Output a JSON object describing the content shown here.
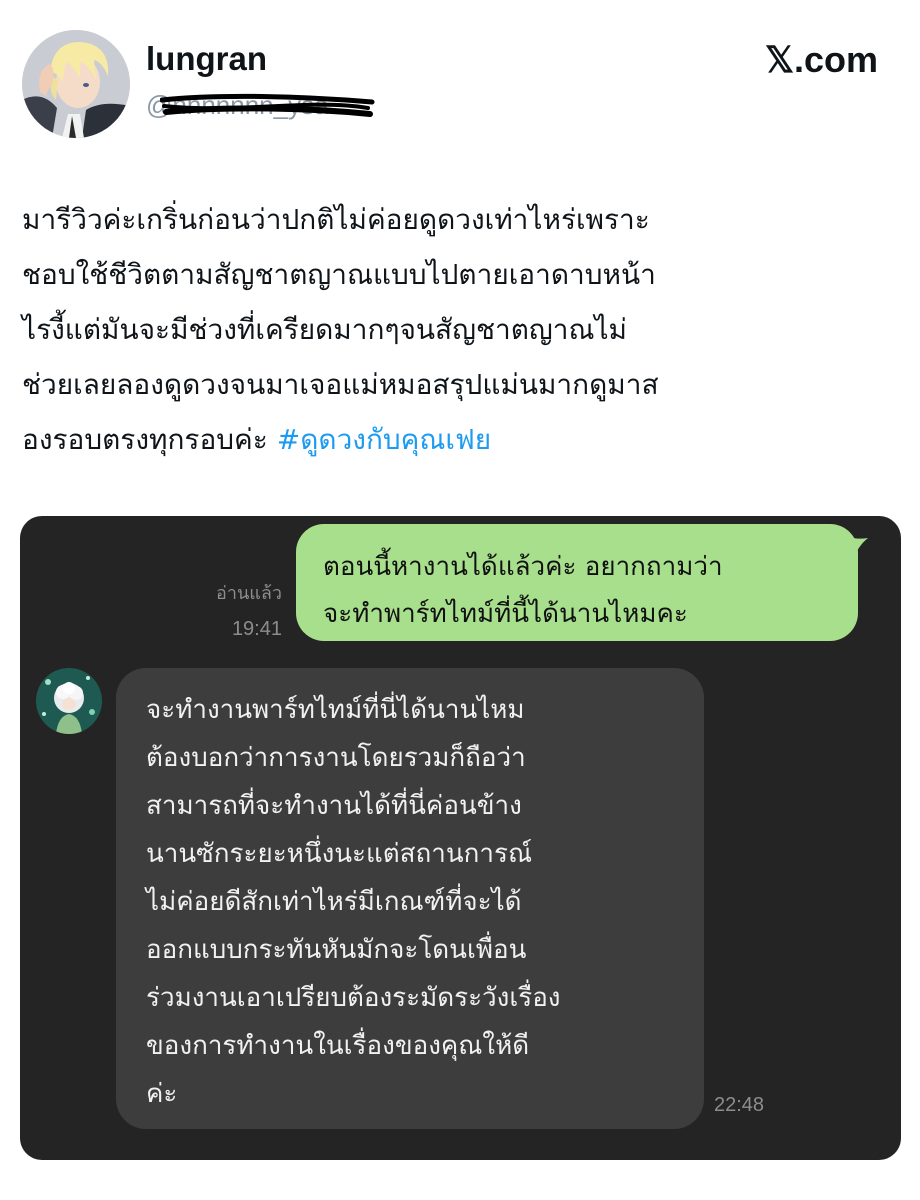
{
  "author": {
    "display_name": "lungran",
    "handle": "@nnnnnnn_ysa"
  },
  "brand": {
    "site_logo": "𝕏.com"
  },
  "tweet": {
    "lines": [
      "มารีวิวค่ะเกริ่นก่อนว่าปกติไม่ค่อยดูดวงเท่าไหร่เพราะ",
      "ชอบใช้ชีวิตตามสัญชาตญาณแบบไปตายเอาดาบหน้า",
      "ไรงี้แต่มันจะมีช่วงที่เครียดมากๆจนสัญชาตญาณไม่",
      "ช่วยเลยลองดูดวงจนมาเจอแม่หมอสรุปแม่นมากดูมาส"
    ],
    "last_line_text": "องรอบตรงทุกรอบค่ะ ",
    "hashtag": "#ดูดวงกับคุณเฟย"
  },
  "chat": {
    "outgoing": {
      "lines": [
        "ตอนนี้หางานได้แล้วค่ะ อยากถามว่า",
        "จะทำพาร์ทไทม์ที่นี้ได้นานไหมคะ"
      ],
      "read_status": "อ่านแล้ว",
      "time": "19:41"
    },
    "incoming": {
      "lines": [
        "จะทำงานพาร์ทไทม์ที่นี่ได้นานไหม",
        "ต้องบอกว่าการงานโดยรวมก็ถือว่า",
        "สามารถที่จะทำงานได้ที่นี่ค่อนข้าง",
        "นานซักระยะหนึ่งนะแต่สถานการณ์",
        "ไม่ค่อยดีสักเท่าไหร่มีเกณฑ์ที่จะได้",
        "ออกแบบกระทันหันมักจะโดนเพื่อน",
        "ร่วมงานเอาเปรียบต้องระมัดระวังเรื่อง",
        "ของการทำงานในเรื่องของคุณให้ดี",
        "ค่ะ"
      ],
      "time": "22:48"
    }
  },
  "icons": {
    "profile_avatar": "anime-avatar-icon",
    "contact_avatar": "contact-avatar-icon"
  },
  "colors": {
    "text": "#0f1419",
    "handle": "#8b98a5",
    "hashtag": "#1d9bf0",
    "media_background": "#242424",
    "outgoing_bubble": "#a8df8c",
    "incoming_bubble": "#3d3d3d",
    "chat_meta": "#8d8d8d"
  }
}
